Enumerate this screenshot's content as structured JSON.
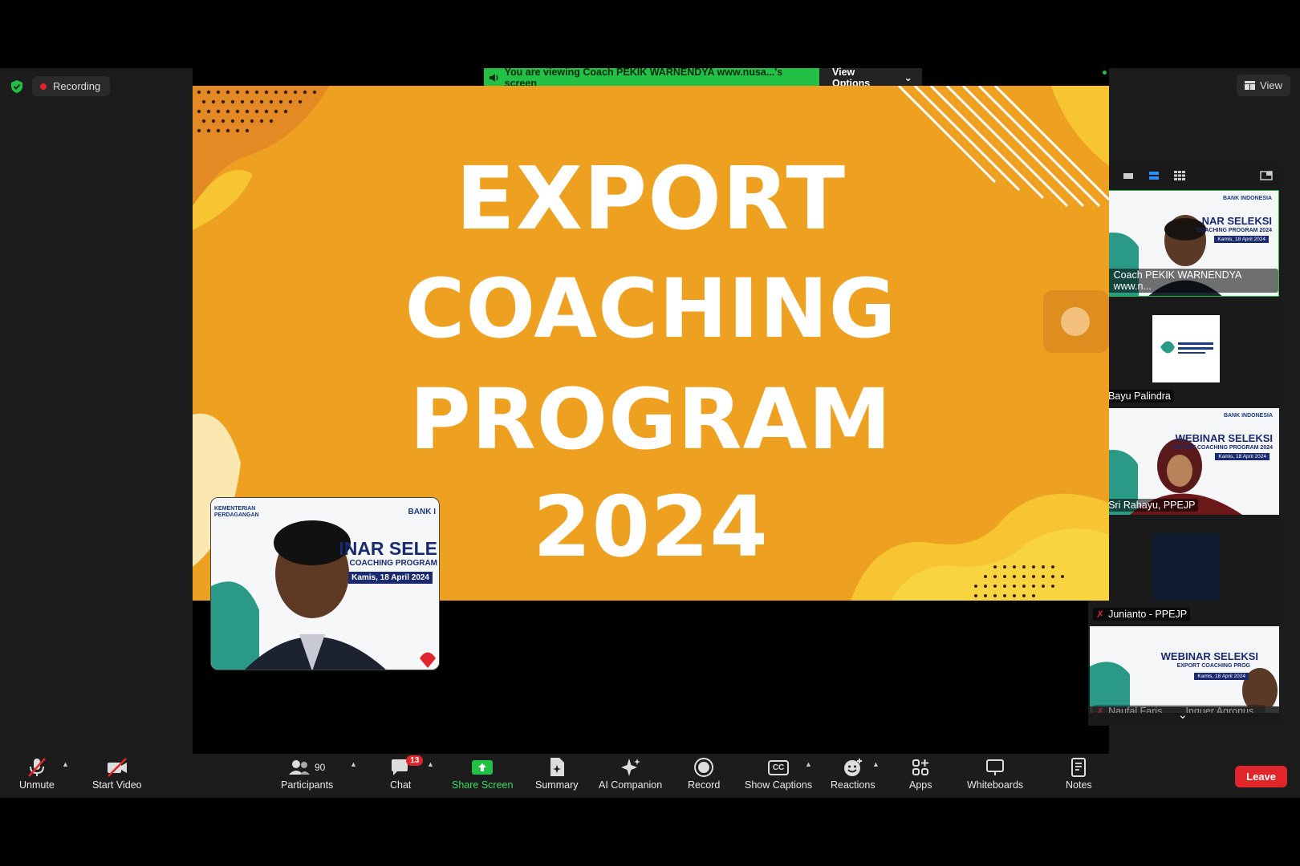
{
  "status": {
    "recording_label": "Recording",
    "view_label": "View"
  },
  "banner": {
    "text": "You are viewing Coach PEKIK WARNENDYA www.nusa...'s screen",
    "options_label": "View Options"
  },
  "slide": {
    "line1": "EXPORT",
    "line2": "COACHING",
    "line3": "PROGRAM",
    "line4": "2024"
  },
  "self_view": {
    "logo_left": "KEMENTERIAN PERDAGANGAN",
    "logo_right": "BANK I",
    "heading": "INAR SELE",
    "subheading": "COACHING PROGRAM",
    "date": "Kamis, 18 April 2024"
  },
  "participants_panel": {
    "tiles": [
      {
        "name": "Coach PEKIK WARNENDYA www.n...",
        "heading": "NAR SELEKSI",
        "sub": "COACHING PROGRAM 2024",
        "date": "Kamis, 18 April 2024",
        "logo": "BANK INDONESIA"
      },
      {
        "name": "Bayu Palindra",
        "logo_text": "KEMENTERIAN PERDAGANGAN REPUBLIK INDONESIA"
      },
      {
        "name": "Sri Rahayu, PPEJP",
        "heading": "WEBINAR SELEKSI",
        "sub": "EXPORT COACHING PROGRAM 2024",
        "date": "Kamis, 18 April 2024",
        "logo": "BANK INDONESIA"
      },
      {
        "name": "Junianto - PPEJP"
      },
      {
        "name": "Naufal Faris",
        "name2": "Inquer Agronus...",
        "heading": "WEBINAR SELEKSI",
        "sub": "EXPORT COACHING PROG",
        "date": "Kamis, 18 April 2024"
      }
    ]
  },
  "toolbar": {
    "unmute": "Unmute",
    "start_video": "Start Video",
    "participants": "Participants",
    "participants_count": "90",
    "chat": "Chat",
    "chat_badge": "13",
    "share_screen": "Share Screen",
    "summary": "Summary",
    "ai_companion": "AI Companion",
    "record": "Record",
    "show_captions": "Show Captions",
    "captions_icon_text": "CC",
    "reactions": "Reactions",
    "apps": "Apps",
    "whiteboards": "Whiteboards",
    "notes": "Notes",
    "leave": "Leave"
  },
  "colors": {
    "share_green": "#23c046",
    "leave_red": "#e0262b",
    "slide_orange": "#eea021"
  }
}
